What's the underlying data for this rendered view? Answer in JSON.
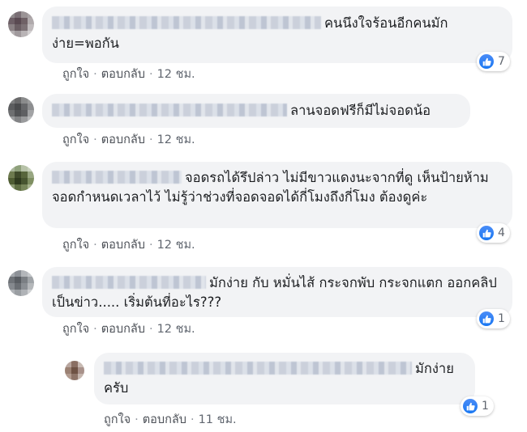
{
  "comments": [
    {
      "text": "คนนึงใจร้อนอีกคนมักง่าย=พอกัน",
      "reaction_count": "7",
      "like_label": "ถูกใจ",
      "reply_label": "ตอบกลับ",
      "time": "12 ชม."
    },
    {
      "text": "ลานจอดฟรีก็มีไม่จอดน้อ",
      "like_label": "ถูกใจ",
      "reply_label": "ตอบกลับ",
      "time": "12 ชม."
    },
    {
      "text": "จอดรถได้รึปล่าว ไม่มีขาวแดงนะจากที่ดู เห็นป้ายห้ามจอดกำหนดเวลาไว้ ไม่รู้ว่าช่วงที่จอดจอดได้กี่โมงถึงกี่โมง ต้องดูค่ะ",
      "reaction_count": "4",
      "like_label": "ถูกใจ",
      "reply_label": "ตอบกลับ",
      "time": "12 ชม."
    },
    {
      "text": "มักง่าย กับ หมั่นไส้ กระจกพับ กระจกแตก ออกคลิปเป็นข่าว..... เริ่มต้นที่อะไร???",
      "reaction_count": "1",
      "like_label": "ถูกใจ",
      "reply_label": "ตอบกลับ",
      "time": "12 ชม."
    }
  ],
  "reply": {
    "text": "มักง่าย ครับ",
    "reaction_count": "1",
    "like_label": "ถูกใจ",
    "reply_label": "ตอบกลับ",
    "time": "11 ชม."
  },
  "colors": {
    "bubble": "#f2f3f5",
    "like_blue": "#1877f2",
    "meta_text": "#4b4f56"
  },
  "icons": [
    "like-icon",
    "avatar"
  ]
}
